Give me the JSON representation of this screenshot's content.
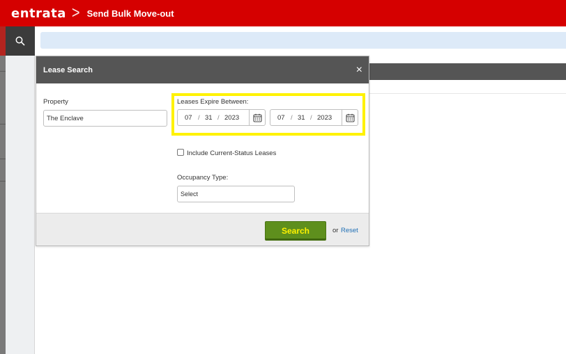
{
  "header": {
    "logo": "entrata",
    "separator": ">",
    "title": "Send Bulk Move-out",
    "color": "#d50000"
  },
  "sidebar": {
    "search_icon": "search-icon"
  },
  "modal": {
    "title": "Lease Search",
    "close_label": "×",
    "property": {
      "label": "Property",
      "value": "The Enclave"
    },
    "lease_expire": {
      "label": "Leases Expire Between:",
      "from": {
        "month": "07",
        "day": "31",
        "year": "2023"
      },
      "to": {
        "month": "07",
        "day": "31",
        "year": "2023"
      },
      "highlight_color": "#fff200"
    },
    "include_current": {
      "label": "Include Current-Status Leases",
      "checked": false
    },
    "occupancy": {
      "label": "Occupancy Type:",
      "value": "Select"
    },
    "search_button": "Search",
    "or_text": "or",
    "reset_link": "Reset"
  }
}
